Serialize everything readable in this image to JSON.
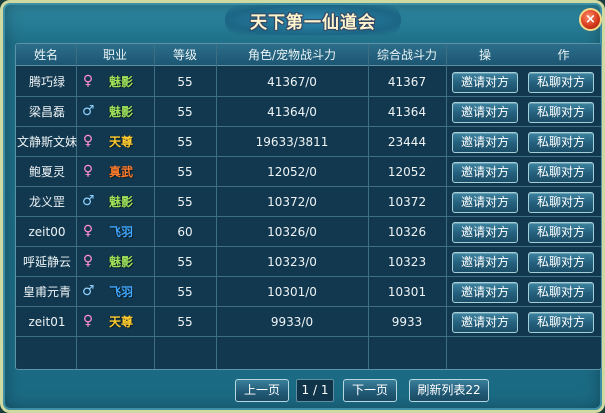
{
  "title": "天下第一仙道会",
  "close_label": "×",
  "headers": [
    "姓名",
    "职业",
    "等级",
    "角色/宠物战斗力",
    "综合战斗力",
    "操",
    "作"
  ],
  "rows": [
    {
      "name": "腾巧绿",
      "gender": "female",
      "gender_symbol": "♀",
      "job": "魅影",
      "job_color": "#9fe25a",
      "level": "55",
      "power": "41367/0",
      "total": "41367",
      "invite": "邀请对方",
      "chat": "私聊对方"
    },
    {
      "name": "梁昌磊",
      "gender": "male",
      "gender_symbol": "♂",
      "job": "魅影",
      "job_color": "#9fe25a",
      "level": "55",
      "power": "41364/0",
      "total": "41364",
      "invite": "邀请对方",
      "chat": "私聊对方"
    },
    {
      "name": "文静斯文妹",
      "gender": "female",
      "gender_symbol": "♀",
      "job": "天尊",
      "job_color": "#ffcc2e",
      "level": "55",
      "power": "19633/3811",
      "total": "23444",
      "invite": "邀请对方",
      "chat": "私聊对方"
    },
    {
      "name": "鲍夏灵",
      "gender": "female",
      "gender_symbol": "♀",
      "job": "真武",
      "job_color": "#ff7a2a",
      "level": "55",
      "power": "12052/0",
      "total": "12052",
      "invite": "邀请对方",
      "chat": "私聊对方"
    },
    {
      "name": "龙义罡",
      "gender": "male",
      "gender_symbol": "♂",
      "job": "魅影",
      "job_color": "#9fe25a",
      "level": "55",
      "power": "10372/0",
      "total": "10372",
      "invite": "邀请对方",
      "chat": "私聊对方"
    },
    {
      "name": "zeit00",
      "gender": "female",
      "gender_symbol": "♀",
      "job": "飞羽",
      "job_color": "#3fa7ff",
      "level": "60",
      "power": "10326/0",
      "total": "10326",
      "invite": "邀请对方",
      "chat": "私聊对方"
    },
    {
      "name": "呼延静云",
      "gender": "female",
      "gender_symbol": "♀",
      "job": "魅影",
      "job_color": "#9fe25a",
      "level": "55",
      "power": "10323/0",
      "total": "10323",
      "invite": "邀请对方",
      "chat": "私聊对方"
    },
    {
      "name": "皇甫元青",
      "gender": "male",
      "gender_symbol": "♂",
      "job": "飞羽",
      "job_color": "#3fa7ff",
      "level": "55",
      "power": "10301/0",
      "total": "10301",
      "invite": "邀请对方",
      "chat": "私聊对方"
    },
    {
      "name": "zeit01",
      "gender": "female",
      "gender_symbol": "♀",
      "job": "天尊",
      "job_color": "#ffcc2e",
      "level": "55",
      "power": "9933/0",
      "total": "9933",
      "invite": "邀请对方",
      "chat": "私聊对方"
    }
  ],
  "colors": {
    "female": "#ff8fd0",
    "male": "#8fd0ff"
  },
  "footer": {
    "prev": "上一页",
    "page": "1 / 1",
    "next": "下一页",
    "refresh": "刷新列表22"
  }
}
